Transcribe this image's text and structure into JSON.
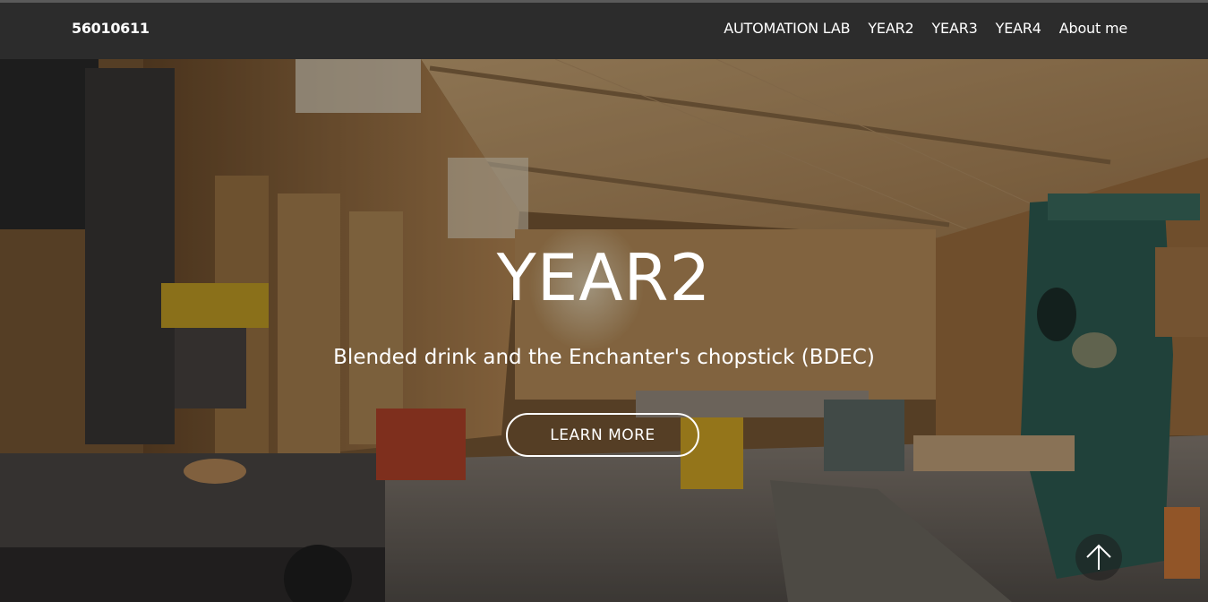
{
  "nav": {
    "brand": "56010611",
    "links": [
      "AUTOMATION LAB",
      "YEAR2",
      "YEAR3",
      "YEAR4",
      "About me"
    ]
  },
  "hero": {
    "title": "YEAR2",
    "subtitle": "Blended drink and the Enchanter's chopstick (BDEC)",
    "button_label": "LEARN MORE",
    "background_image": "woodworking-workshop-photo"
  },
  "scroll_top": {
    "icon": "arrow-up-icon"
  },
  "colors": {
    "navbar": "#2c2c2c",
    "text": "#ffffff",
    "overlay": "rgba(0,0,0,0.30)"
  }
}
